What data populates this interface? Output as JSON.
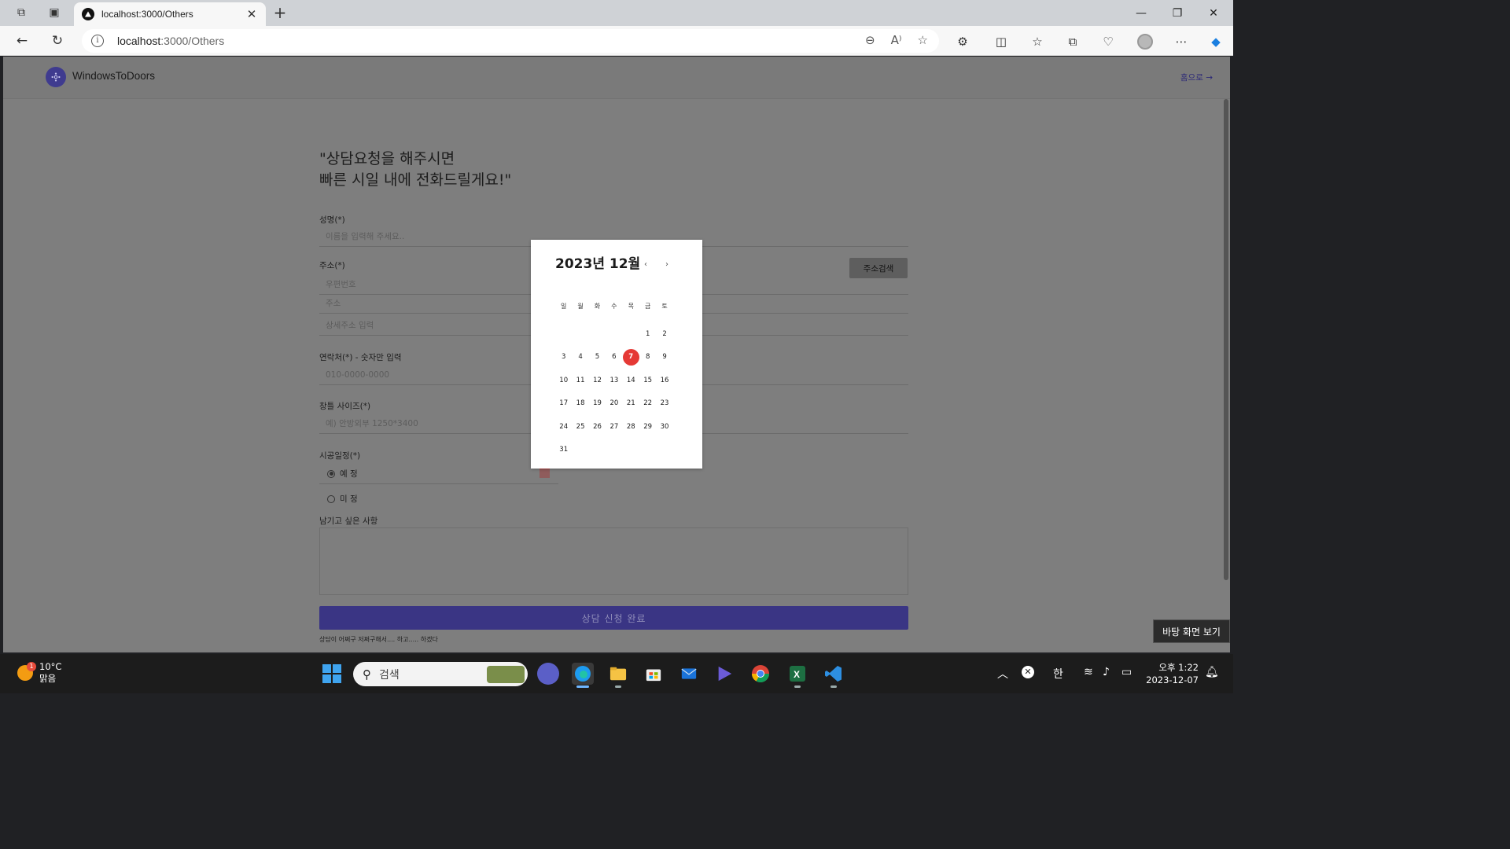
{
  "browser": {
    "tab_title": "localhost:3000/Others",
    "url_host": "localhost",
    "url_path": ":3000/Others"
  },
  "app": {
    "brand": "WindowsToDoors",
    "home_link": "홈으로 →"
  },
  "form": {
    "headline_line1": "\"상담요청을 해주시면",
    "headline_line2": "빠른 시일 내에 전화드릴게요!\"",
    "name_label": "성명(*)",
    "name_placeholder": "이름을 입력해 주세요..",
    "address_label": "주소(*)",
    "postcode_placeholder": "우편번호",
    "address_placeholder": "주소",
    "address_detail_placeholder": "상세주소 입력",
    "address_search_button": "주소검색",
    "phone_label": "연락처(*) - 숫자만 입력",
    "phone_placeholder": "010-0000-0000",
    "window_size_label": "창틀 사이즈(*)",
    "window_size_placeholder": "예) 안방외부 1250*3400",
    "schedule_label": "시공일정(*)",
    "schedule_option_planned": "예 정",
    "schedule_option_undecided": "미 정",
    "memo_label": "남기고 싶은 사항",
    "submit_button": "상담 신청 완료",
    "footnote": "상담이 어쩌구 저쩌구해서.... 하고..... 하겠다"
  },
  "calendar": {
    "title": "2023년 12월",
    "prev": "‹",
    "next": "›",
    "weekdays": [
      "일",
      "월",
      "화",
      "수",
      "목",
      "금",
      "토"
    ],
    "leading_blanks": 5,
    "days_in_month": 31,
    "selected_day": 7,
    "selected_color": "#e53935"
  },
  "tooltip": "바탕 화면 보기",
  "taskbar": {
    "weather_badge": "1",
    "temperature": "10°C",
    "weather": "맑음",
    "search_placeholder": "검색",
    "ime": "한",
    "time": "오후 1:22",
    "date": "2023-12-07"
  },
  "colors": {
    "overlay": "#7e7e7e",
    "submit": "#3a3584",
    "brand_logo": "#3f3b8f"
  }
}
